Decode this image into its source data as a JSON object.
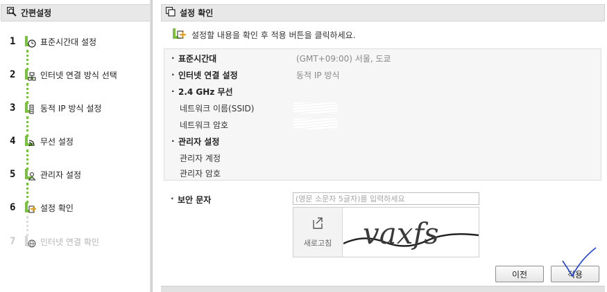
{
  "sidebar": {
    "title": "간편설정",
    "steps": [
      {
        "num": "1",
        "label": "표준시간대 설정"
      },
      {
        "num": "2",
        "label": "인터넷 연결 방식 선택"
      },
      {
        "num": "3",
        "label": "동적 IP 방식 설정"
      },
      {
        "num": "4",
        "label": "무선 설정"
      },
      {
        "num": "5",
        "label": "관리자 설정"
      },
      {
        "num": "6",
        "label": "설정 확인"
      },
      {
        "num": "7",
        "label": "인터넷 연결 확인"
      }
    ]
  },
  "main": {
    "title": "설정 확인",
    "instruction": "설정할 내용을 확인 후 적용 버튼을 클릭하세요.",
    "summary": {
      "timezone_label": "표준시간대",
      "timezone_value": "(GMT+09:00) 서울, 도쿄",
      "internet_label": "인터넷 연결 설정",
      "internet_value": "동적 IP 방식",
      "wireless_label": "2.4 GHz 무선",
      "ssid_label": "네트워크 이름(SSID)",
      "wifi_password_label": "네트워크 암호",
      "admin_label": "관리자 설정",
      "admin_account_label": "관리자 계정",
      "admin_password_label": "관리자 암호"
    },
    "security": {
      "label": "보안 문자",
      "placeholder": "(영문 소문자 5글자)를 입력하세요",
      "refresh_label": "새로고침",
      "captcha_text": "vaxfs"
    },
    "buttons": {
      "prev": "이전",
      "apply": "적용"
    }
  },
  "colors": {
    "accent_green": "#7cc043",
    "header_bg": "#e8e8e8",
    "checkmark_blue": "#1a3fd8"
  }
}
